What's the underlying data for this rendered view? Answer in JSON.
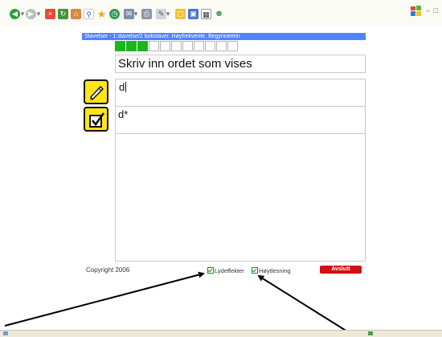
{
  "window": {
    "title": "Stavelser - 1 stavelse/2 bokstaver. Høyfrekvente. Begynnertrin"
  },
  "toolbar": {
    "icons": [
      "back-icon",
      "forward-icon",
      "stop-icon",
      "refresh-icon",
      "home-icon",
      "search-icon",
      "favorites-icon",
      "history-icon",
      "mail-icon",
      "print-icon",
      "edit-icon",
      "folder-icon",
      "messenger-icon",
      "calculator-icon"
    ]
  },
  "progress": {
    "completed": 3,
    "total": 11
  },
  "prompt": {
    "text": "Skriv inn ordet som vises"
  },
  "input": {
    "value": "d"
  },
  "answer": {
    "value": "d*"
  },
  "footer": {
    "copyright": "Copyright 2006",
    "sound_effects_label": "Lydeffekter",
    "reading_aloud_label": "Høytlesning",
    "sound_effects_checked": true,
    "reading_aloud_checked": true,
    "quit_label": "Avslutt"
  },
  "colors": {
    "title_bar": "#4f83ff",
    "progress_done": "#1fb31f",
    "icon_button": "#ffe419",
    "quit_button": "#d20f14"
  }
}
